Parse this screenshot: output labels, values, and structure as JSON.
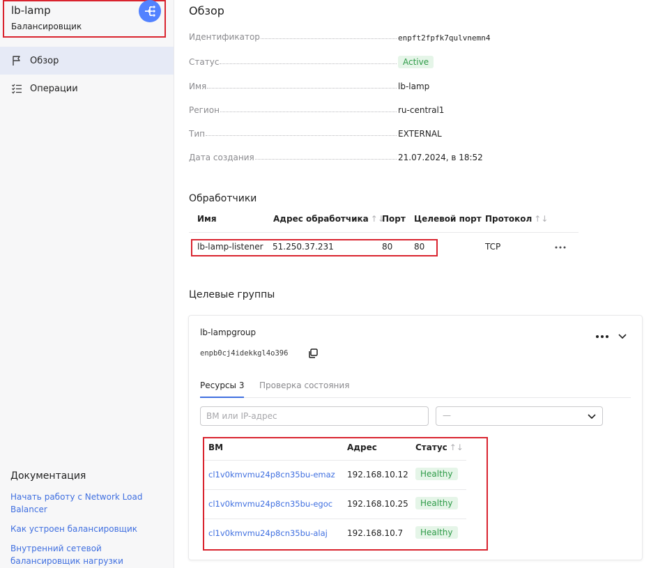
{
  "sidebar": {
    "title": "lb-lamp",
    "subtitle": "Балансировщик",
    "nav": [
      {
        "label": "Обзор",
        "icon": "flag-icon",
        "active": true
      },
      {
        "label": "Операции",
        "icon": "checklist-icon",
        "active": false
      }
    ],
    "docs_title": "Документация",
    "doc_links": [
      "Начать работу с Network Load Balancer",
      "Как устроен балансировщик",
      "Внутренний сетевой балансировщик нагрузки"
    ]
  },
  "overview": {
    "title": "Обзор",
    "fields": [
      {
        "key": "Идентификатор",
        "value": "enpft2fpfk7qulvnemn4",
        "type": "mono"
      },
      {
        "key": "Статус",
        "value": "Active",
        "type": "badge"
      },
      {
        "key": "Имя",
        "value": "lb-lamp",
        "type": "text"
      },
      {
        "key": "Регион",
        "value": "ru-central1",
        "type": "text"
      },
      {
        "key": "Тип",
        "value": "EXTERNAL",
        "type": "text"
      },
      {
        "key": "Дата создания",
        "value": "21.07.2024, в 18:52",
        "type": "text"
      }
    ]
  },
  "listeners": {
    "title": "Обработчики",
    "columns": [
      "Имя",
      "Адрес обработчика",
      "Порт",
      "Целевой порт",
      "Протокол"
    ],
    "sort_glyph": "↑↓",
    "rows": [
      {
        "name": "lb-lamp-listener",
        "address": "51.250.37.231",
        "port": "80",
        "target_port": "80",
        "protocol": "TCP"
      }
    ]
  },
  "target_groups": {
    "title": "Целевые группы",
    "group": {
      "name": "lb-lampgroup",
      "id": "enpb0cj4idekkgl4o396",
      "tabs": [
        "Ресурсы 3",
        "Проверка состояния"
      ],
      "active_tab": 0,
      "search_placeholder": "ВМ или IP-адрес",
      "select_value": "—",
      "columns": [
        "ВМ",
        "Адрес",
        "Статус"
      ],
      "rows": [
        {
          "vm": "cl1v0kmvmu24p8cn35bu-emaz",
          "address": "192.168.10.12",
          "status": "Healthy"
        },
        {
          "vm": "cl1v0kmvmu24p8cn35bu-egoc",
          "address": "192.168.10.25",
          "status": "Healthy"
        },
        {
          "vm": "cl1v0kmvmu24p8cn35bu-alaj",
          "address": "192.168.10.7",
          "status": "Healthy"
        }
      ]
    }
  },
  "colors": {
    "accent": "#5282ff",
    "link": "#3f6fe0",
    "highlight_box": "#d9232e",
    "badge_green_bg": "#e5f5e8",
    "badge_green_text": "#2e9b48"
  }
}
